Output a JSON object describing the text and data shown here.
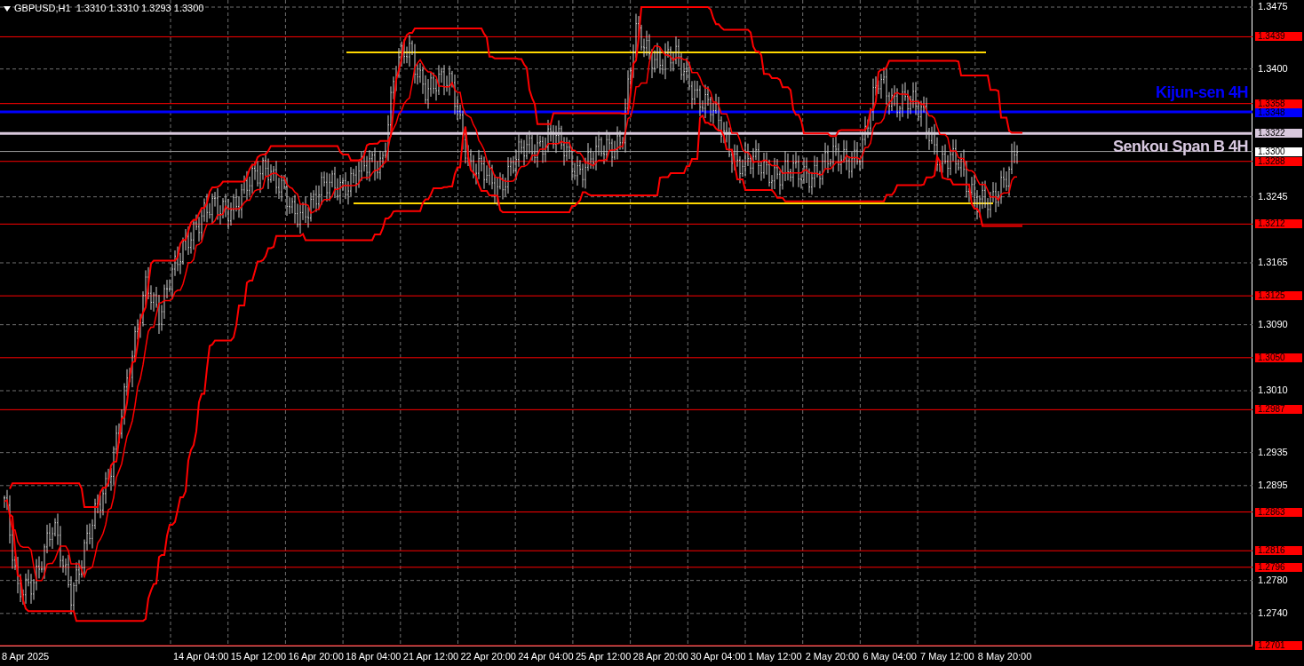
{
  "chart": {
    "header": {
      "text": "GBPUSD,H1  1.3310 1.3310 1.3293 1.3300"
    },
    "annotations": [
      {
        "kind": "kijun",
        "text": "Kijun-sen 4H"
      },
      {
        "kind": "senkou",
        "text": "Senkou Span B 4H"
      }
    ],
    "price_ticks": [
      "1.3475",
      "1.3400",
      "1.3245",
      "1.3165",
      "1.3090",
      "1.3010",
      "1.2935",
      "1.2895",
      "1.2780",
      "1.2740"
    ],
    "level_labels": [
      {
        "kind": "level",
        "text": "1.3439"
      },
      {
        "kind": "level",
        "text": "1.3358"
      },
      {
        "kind": "kijun",
        "text": "1.3348"
      },
      {
        "kind": "senkou",
        "text": "1.3322"
      },
      {
        "kind": "price",
        "text": "1.3300"
      },
      {
        "kind": "level",
        "text": "1.3288"
      },
      {
        "kind": "level",
        "text": "1.3212"
      },
      {
        "kind": "level",
        "text": "1.3125"
      },
      {
        "kind": "level",
        "text": "1.3050"
      },
      {
        "kind": "level",
        "text": "1.2987"
      },
      {
        "kind": "level",
        "text": "1.2863"
      },
      {
        "kind": "level",
        "text": "1.2816"
      },
      {
        "kind": "level",
        "text": "1.2796"
      },
      {
        "kind": "level",
        "text": "1.2701"
      }
    ],
    "time_labels": [
      "8 Apr 2025",
      "14 Apr 04:00",
      "15 Apr 12:00",
      "16 Apr 20:00",
      "18 Apr 04:00",
      "21 Apr 12:00",
      "22 Apr 20:00",
      "24 Apr 04:00",
      "25 Apr 12:00",
      "28 Apr 20:00",
      "30 Apr 04:00",
      "1 May 12:00",
      "2 May 20:00",
      "6 May 04:00",
      "7 May 12:00",
      "8 May 20:00"
    ]
  }
}
